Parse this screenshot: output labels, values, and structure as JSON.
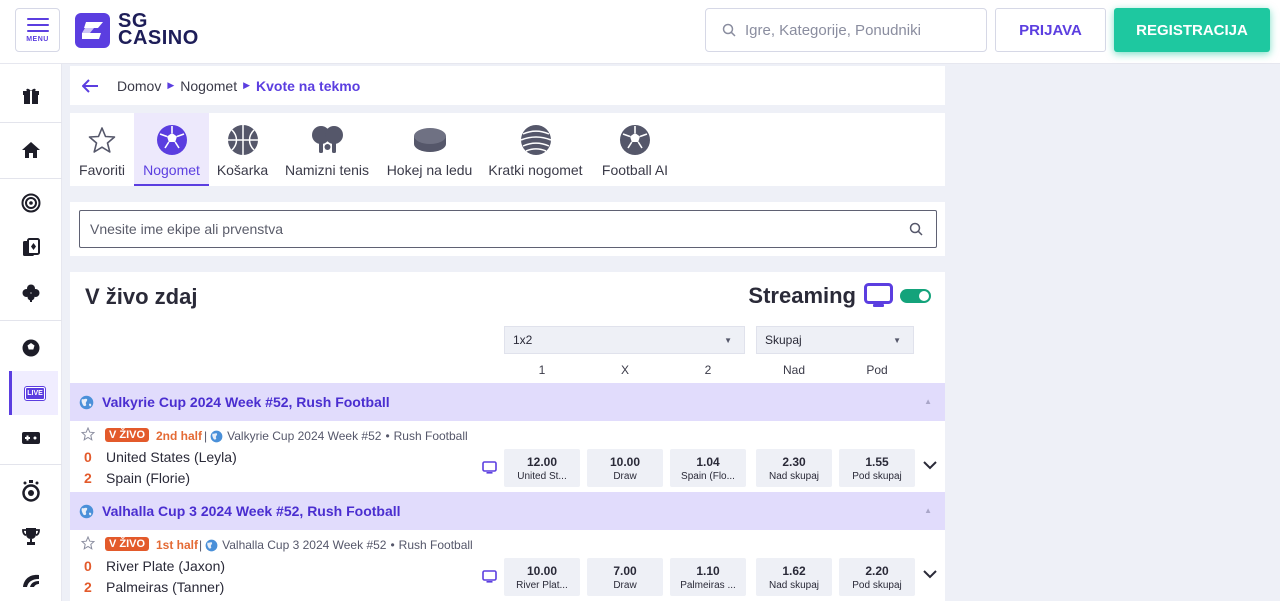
{
  "header": {
    "menu_label": "MENU",
    "logo_line1": "SG",
    "logo_line2": "CASINO",
    "search_placeholder": "Igre, Kategorije, Ponudniki",
    "login_label": "PRIJAVA",
    "register_label": "REGISTRACIJA"
  },
  "rail": {
    "items": [
      "gift-icon",
      "home-icon",
      "roulette-icon",
      "cards-icon",
      "clover-icon",
      "football-icon",
      "live-icon",
      "gamepad-icon",
      "stopwatch-icon",
      "trophy-icon",
      "aviator-icon"
    ],
    "live_tag": "LIVE"
  },
  "breadcrumb": {
    "home": "Domov",
    "sport": "Nogomet",
    "current": "Kvote na tekmo"
  },
  "sports": [
    {
      "label": "Favoriti",
      "icon": "star-icon"
    },
    {
      "label": "Nogomet",
      "icon": "soccer-ball-icon"
    },
    {
      "label": "Košarka",
      "icon": "basketball-icon"
    },
    {
      "label": "Namizni tenis",
      "icon": "table-tennis-icon"
    },
    {
      "label": "Hokej na ledu",
      "icon": "hockey-puck-icon"
    },
    {
      "label": "Kratki nogomet",
      "icon": "futsal-icon"
    },
    {
      "label": "Football AI",
      "icon": "football-ai-icon"
    }
  ],
  "active_sport": "Nogomet",
  "team_search": {
    "placeholder": "Vnesite ime ekipe ali prvenstva"
  },
  "live": {
    "title": "V živo zdaj",
    "streaming_label": "Streaming",
    "streaming_on": true,
    "market_1": "1x2",
    "market_2": "Skupaj",
    "col_1": "1",
    "col_x": "X",
    "col_2": "2",
    "col_over": "Nad",
    "col_under": "Pod"
  },
  "leagues": [
    {
      "name": "Valkyrie Cup 2024 Week #52, Rush Football",
      "match": {
        "badge": "V ŽIVO",
        "period": "2nd half",
        "league_short": "Valkyrie Cup 2024 Week #52",
        "category": "Rush Football",
        "home_score": "0",
        "home_team": "United States (Leyla)",
        "away_score": "2",
        "away_team": "Spain (Florie)",
        "odds": [
          {
            "value": "12.00",
            "label": "United St..."
          },
          {
            "value": "10.00",
            "label": "Draw"
          },
          {
            "value": "1.04",
            "label": "Spain (Flo..."
          },
          {
            "value": "2.30",
            "label": "Nad skupaj"
          },
          {
            "value": "1.55",
            "label": "Pod skupaj"
          }
        ]
      }
    },
    {
      "name": "Valhalla Cup 3 2024 Week #52, Rush Football",
      "match": {
        "badge": "V ŽIVO",
        "period": "1st half",
        "league_short": "Valhalla Cup 3 2024 Week #52",
        "category": "Rush Football",
        "home_score": "0",
        "home_team": "River Plate (Jaxon)",
        "away_score": "2",
        "away_team": "Palmeiras (Tanner)",
        "odds": [
          {
            "value": "10.00",
            "label": "River Plat..."
          },
          {
            "value": "7.00",
            "label": "Draw"
          },
          {
            "value": "1.10",
            "label": "Palmeiras ..."
          },
          {
            "value": "1.62",
            "label": "Nad skupaj"
          },
          {
            "value": "2.20",
            "label": "Pod skupaj"
          }
        ]
      }
    }
  ],
  "colors": {
    "brand": "#5b3ee0",
    "cta": "#1ec8a0",
    "live": "#e35a2b",
    "toggle": "#14a37b"
  }
}
